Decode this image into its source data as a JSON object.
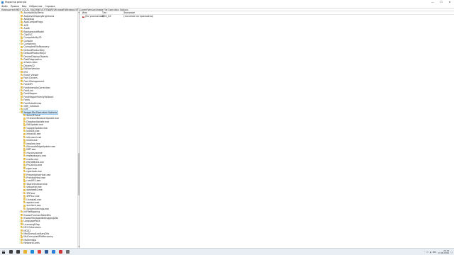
{
  "window": {
    "title": "Редактор реестра",
    "buttons": [
      "—",
      "☐",
      "✕"
    ]
  },
  "menu": [
    "Файл",
    "Правка",
    "Вид",
    "Избранное",
    "Справка"
  ],
  "address": "Компьютер\\HKEY_LOCAL_MACHINE\\SOFTWARE\\Microsoft\\Windows NT\\CurrentVersion\\Image File Execution Options",
  "tree": [
    {
      "label": "AccessibilityTemp",
      "expander": "›"
    },
    {
      "label": "AdaptiveDisplayBrightness",
      "expander": ""
    },
    {
      "label": "AeDebug",
      "expander": ""
    },
    {
      "label": "AppCompatFlags",
      "expander": "›"
    },
    {
      "label": "ASR",
      "expander": "›"
    },
    {
      "label": "Audit",
      "expander": "›"
    },
    {
      "label": "BackgroundModel",
      "expander": "›"
    },
    {
      "label": "ClipSVC",
      "expander": "›"
    },
    {
      "label": "Compatibility32",
      "expander": ""
    },
    {
      "label": "Console",
      "expander": "›"
    },
    {
      "label": "Containers",
      "expander": "›"
    },
    {
      "label": "CorruptedFileRecovery",
      "expander": ""
    },
    {
      "label": "DefaultProductKey",
      "expander": ""
    },
    {
      "label": "DefaultProductKey2",
      "expander": "›"
    },
    {
      "label": "DeviceDisplayObjects",
      "expander": ""
    },
    {
      "label": "DiskDiagnostics",
      "expander": ""
    },
    {
      "label": "drivers.desc",
      "expander": ""
    },
    {
      "label": "Drivers32",
      "expander": ""
    },
    {
      "label": "EditionVersion",
      "expander": ""
    },
    {
      "label": "EFS",
      "expander": "›"
    },
    {
      "label": "Event Viewer",
      "expander": ""
    },
    {
      "label": "Font Drivers",
      "expander": ""
    },
    {
      "label": "Font Management",
      "expander": "›"
    },
    {
      "label": "FontDPI",
      "expander": ""
    },
    {
      "label": "FontIntensityCorrection",
      "expander": ""
    },
    {
      "label": "FontLink",
      "expander": "›"
    },
    {
      "label": "FontMapper",
      "expander": ""
    },
    {
      "label": "FontMapperFamilyFallback",
      "expander": ""
    },
    {
      "label": "Fonts",
      "expander": ""
    },
    {
      "label": "FontSubstitutes",
      "expander": ""
    },
    {
      "label": "GRE_Initialize",
      "expander": "›"
    },
    {
      "label": "ICM",
      "expander": "›"
    },
    {
      "label": "Image File Execution Options",
      "expander": "⌄",
      "selected": true
    },
    {
      "label": "AcroCEF.exe",
      "expander": "",
      "indent": 1
    },
    {
      "label": "CCleanerBrowserUpdate.exe",
      "expander": "",
      "indent": 1
    },
    {
      "label": "DropboxUpdate.exe",
      "expander": "",
      "indent": 1
    },
    {
      "label": "EdfUpdate.exe",
      "expander": "",
      "indent": 1
    },
    {
      "label": "GoogleUpdate.exe",
      "expander": "",
      "indent": 1
    },
    {
      "label": "iaStorE.exe",
      "expander": "",
      "indent": 1
    },
    {
      "label": "ielowutil.exe",
      "expander": "",
      "indent": 1
    },
    {
      "label": "iefrcoord.exe",
      "expander": "",
      "indent": 1
    },
    {
      "label": "iexdit.exe",
      "expander": "",
      "indent": 1
    },
    {
      "label": "iexplore.exe",
      "expander": "",
      "indent": 1
    },
    {
      "label": "MicrosoftEdgeUpdate.exe",
      "expander": "",
      "indent": 1
    },
    {
      "label": "MRT.exe",
      "expander": "",
      "indent": 1
    },
    {
      "label": "mscorsvw.exe",
      "expander": "",
      "indent": 1
    },
    {
      "label": "msfeedssync.exe",
      "expander": "",
      "indent": 1
    },
    {
      "label": "mshta.exe",
      "expander": "",
      "indent": 1
    },
    {
      "label": "MSOXMLEd.exe",
      "expander": "",
      "indent": 1
    },
    {
      "label": "PhCalcUp.exe",
      "expander": "",
      "indent": 1
    },
    {
      "label": "ngen.exe",
      "expander": "",
      "indent": 1
    },
    {
      "label": "ngentask.exe",
      "expander": "",
      "indent": 1
    },
    {
      "label": "PresentationHost.exe",
      "expander": "",
      "indent": 1
    },
    {
      "label": "PrintIsolHost.exe",
      "expander": "",
      "indent": 1
    },
    {
      "label": "rundll32.exe",
      "expander": "",
      "indent": 1
    },
    {
      "label": "SearchIndexer.exe",
      "expander": "",
      "indent": 1
    },
    {
      "label": "setupexe.exe",
      "expander": "",
      "indent": 1
    },
    {
      "label": "splwow64.exe",
      "expander": "",
      "indent": 1
    },
    {
      "label": "SPP.exe",
      "expander": "›",
      "indent": 1
    },
    {
      "label": "SPPSvc.exe",
      "expander": "",
      "indent": 1
    },
    {
      "label": "Uninstall.exe",
      "expander": "",
      "indent": 1
    },
    {
      "label": "wpsbin.exe",
      "expander": "",
      "indent": 1
    },
    {
      "label": "wuclient.exe",
      "expander": "",
      "indent": 1
    },
    {
      "label": "SystemSettings.exe",
      "expander": "",
      "indent": 1
    },
    {
      "label": "IniFileMapping",
      "expander": "›"
    },
    {
      "label": "KnownFunctionTableDlls",
      "expander": ""
    },
    {
      "label": "KnownManagedDebuggingDlls",
      "expander": ""
    },
    {
      "label": "LanguagePack",
      "expander": "›"
    },
    {
      "label": "LicensingDiag",
      "expander": ""
    },
    {
      "label": "MCI Extensions",
      "expander": ""
    },
    {
      "label": "MCI32",
      "expander": ""
    },
    {
      "label": "MiniDumpAuxiliaryDlls",
      "expander": ""
    },
    {
      "label": "MsiCorruptedFileRecovery",
      "expander": ""
    },
    {
      "label": "Multimedia",
      "expander": "›"
    },
    {
      "label": "NetworkCards",
      "expander": "›"
    }
  ],
  "values": {
    "headers": {
      "name": "Имя",
      "type": "Тип",
      "data": "Значение"
    },
    "rows": [
      {
        "name": "(По умолчанию)",
        "type": "REG_SZ",
        "data": "(значение не присвоено)"
      }
    ]
  },
  "taskbar": {
    "apps": [
      {
        "name": "search",
        "color": "#3c3c3c"
      },
      {
        "name": "task-view",
        "color": "#3c3c3c"
      },
      {
        "name": "file-explorer",
        "color": "#e8b32c"
      },
      {
        "name": "edge",
        "color": "#1f8ad2"
      },
      {
        "name": "chrome",
        "color": "#e2473c"
      },
      {
        "name": "word",
        "color": "#2b5797"
      },
      {
        "name": "registry-editor",
        "color": "#2e7dd7",
        "active": true
      },
      {
        "name": "app-red",
        "color": "#d13438"
      },
      {
        "name": "app-gray",
        "color": "#6b6b6b"
      }
    ],
    "tray": {
      "lang": "РУС",
      "time": "20:14",
      "date": "17.06.2021"
    }
  }
}
